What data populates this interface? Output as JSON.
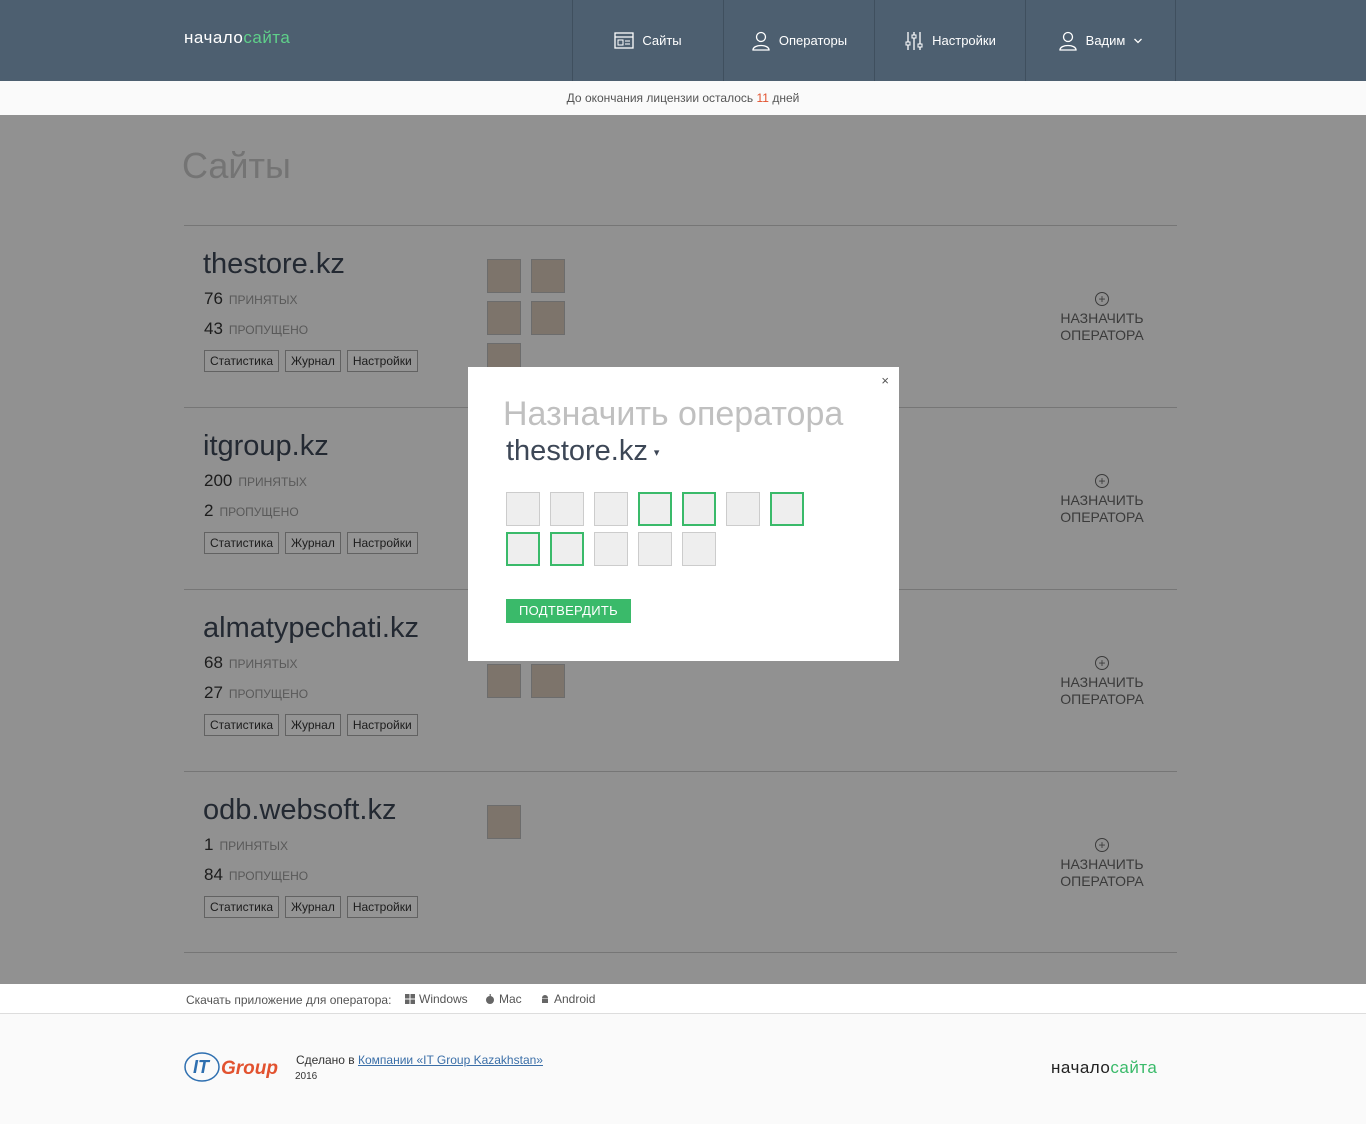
{
  "header": {
    "logo_part1": "начало",
    "logo_part2": "сайта",
    "nav": [
      {
        "label": "Сайты",
        "icon": "sites-icon"
      },
      {
        "label": "Операторы",
        "icon": "user-icon"
      },
      {
        "label": "Настройки",
        "icon": "sliders-icon"
      },
      {
        "label": "Вадим",
        "icon": "user-icon"
      }
    ]
  },
  "license": {
    "prefix": "До окончания лицензии осталось",
    "days": "11",
    "suffix": "дней"
  },
  "page_title": "Сайты",
  "labels": {
    "accepted": "ПРИНЯТЫХ",
    "missed": "ПРОПУЩЕНО",
    "stats": "Статистика",
    "journal": "Журнал",
    "settings": "Настройки",
    "assign_1": "НАЗНАЧИТЬ",
    "assign_2": "ОПЕРАТОРА"
  },
  "sites": [
    {
      "name": "thestore.kz",
      "accepted": "76",
      "missed": "43",
      "avatars": 5
    },
    {
      "name": "itgroup.kz",
      "accepted": "200",
      "missed": "2",
      "avatars": 0
    },
    {
      "name": "almatypechati.kz",
      "accepted": "68",
      "missed": "27",
      "avatars": 2
    },
    {
      "name": "odb.websoft.kz",
      "accepted": "1",
      "missed": "84",
      "avatars": 1
    }
  ],
  "modal": {
    "close": "×",
    "title": "Назначить оператора",
    "site": "thestore.kz",
    "operators_selected": [
      false,
      false,
      false,
      true,
      true,
      false,
      true,
      true,
      true,
      false,
      false,
      false
    ],
    "confirm": "ПОДТВЕРДИТЬ"
  },
  "download": {
    "label": "Скачать приложение для оператора:",
    "windows": "Windows",
    "mac": "Mac",
    "android": "Android"
  },
  "footer": {
    "itg_it": "IT",
    "itg_group": "Group",
    "made_by": "Сделано в",
    "company": "Компании «IT Group Kazakhstan»",
    "year": "2016",
    "logo_part1": "начало",
    "logo_part2": "сайта"
  },
  "colors": {
    "header": "#4d5f70",
    "accent_green": "#3aba6a",
    "days_red": "#e2522f"
  }
}
